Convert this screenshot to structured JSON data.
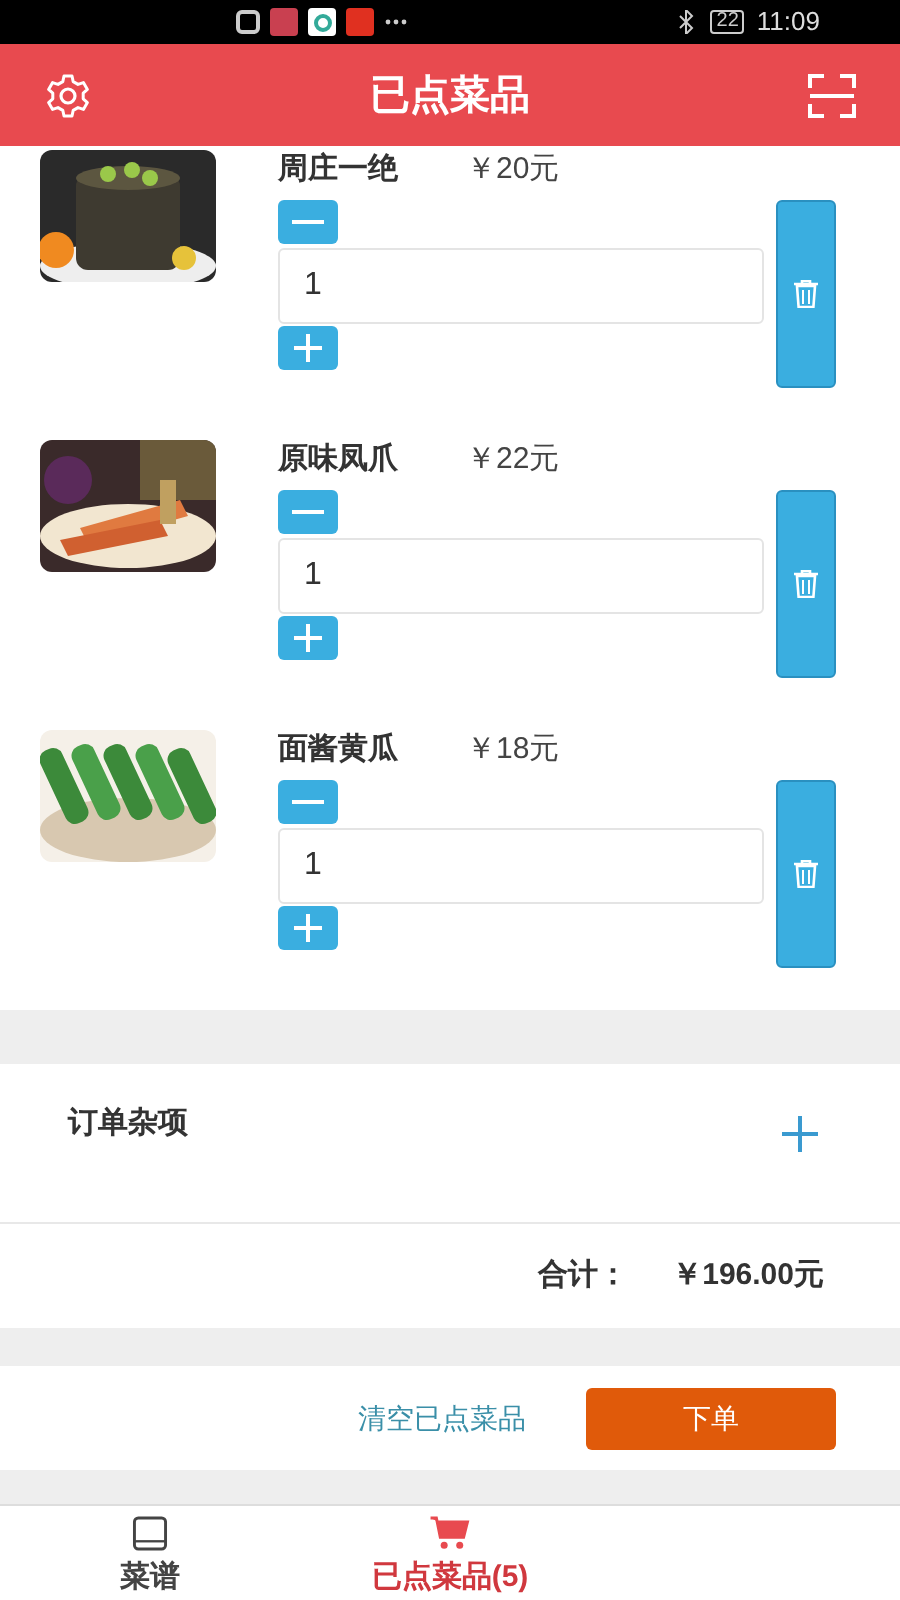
{
  "status_bar": {
    "battery": "22",
    "time": "11:09"
  },
  "header": {
    "title": "已点菜品"
  },
  "dishes": [
    {
      "name": "周庄一绝",
      "price": "￥20元",
      "quantity": "1"
    },
    {
      "name": "原味凤爪",
      "price": "￥22元",
      "quantity": "1"
    },
    {
      "name": "面酱黄瓜",
      "price": "￥18元",
      "quantity": "1"
    }
  ],
  "misc": {
    "label": "订单杂项"
  },
  "total": {
    "label": "合计：",
    "amount": "￥196.00元"
  },
  "actions": {
    "clear": "清空已点菜品",
    "submit": "下单"
  },
  "tabs": [
    {
      "kind": "menu",
      "label": "菜谱",
      "selected": false
    },
    {
      "kind": "cart",
      "label": "已点菜品(5)",
      "selected": true
    }
  ]
}
